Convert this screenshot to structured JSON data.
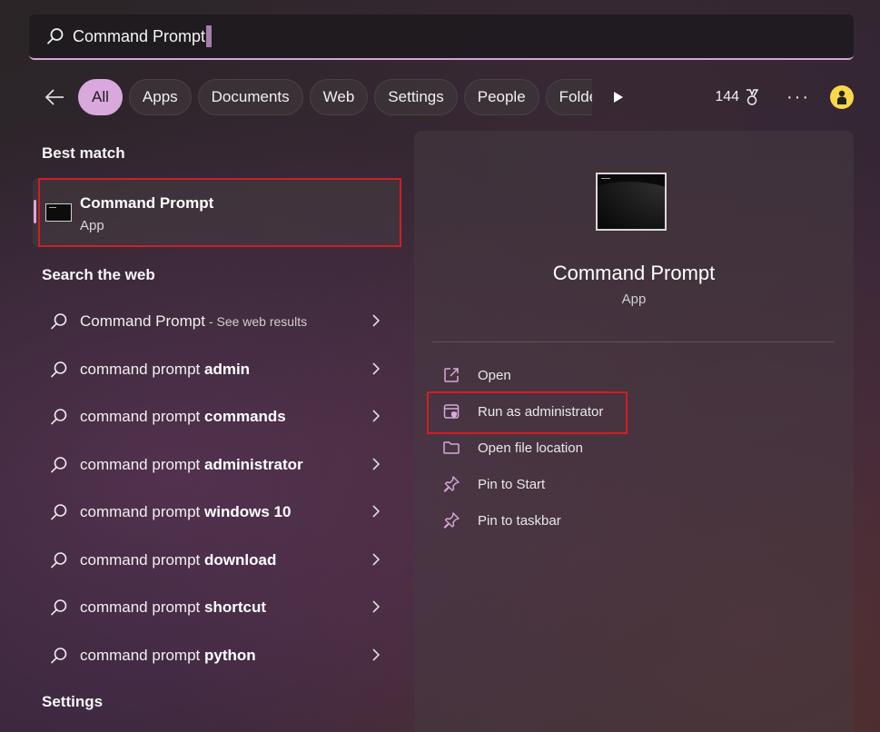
{
  "search": {
    "query": "Command Prompt"
  },
  "filters": {
    "items": [
      "All",
      "Apps",
      "Documents",
      "Web",
      "Settings",
      "People",
      "Folde"
    ],
    "active": "All",
    "points": "144"
  },
  "best_match": {
    "heading": "Best match",
    "title": "Command Prompt",
    "subtitle": "App"
  },
  "web": {
    "heading": "Search the web",
    "items": [
      {
        "prefix": "Command Prompt",
        "bold": "",
        "suffix": "- See web results"
      },
      {
        "prefix": "command prompt ",
        "bold": "admin",
        "suffix": ""
      },
      {
        "prefix": "command prompt ",
        "bold": "commands",
        "suffix": ""
      },
      {
        "prefix": "command prompt ",
        "bold": "administrator",
        "suffix": ""
      },
      {
        "prefix": "command prompt ",
        "bold": "windows 10",
        "suffix": ""
      },
      {
        "prefix": "command prompt ",
        "bold": "download",
        "suffix": ""
      },
      {
        "prefix": "command prompt ",
        "bold": "shortcut",
        "suffix": ""
      },
      {
        "prefix": "command prompt ",
        "bold": "python",
        "suffix": ""
      }
    ]
  },
  "settings_heading": "Settings",
  "detail": {
    "title": "Command Prompt",
    "subtitle": "App",
    "actions": [
      {
        "label": "Open",
        "icon": "open-external-icon"
      },
      {
        "label": "Run as administrator",
        "icon": "shield-admin-icon"
      },
      {
        "label": "Open file location",
        "icon": "folder-icon"
      },
      {
        "label": "Pin to Start",
        "icon": "pin-icon"
      },
      {
        "label": "Pin to taskbar",
        "icon": "pin-icon"
      }
    ]
  },
  "colors": {
    "accent": "#d9a8dc",
    "highlight_box": "#d01e24"
  }
}
